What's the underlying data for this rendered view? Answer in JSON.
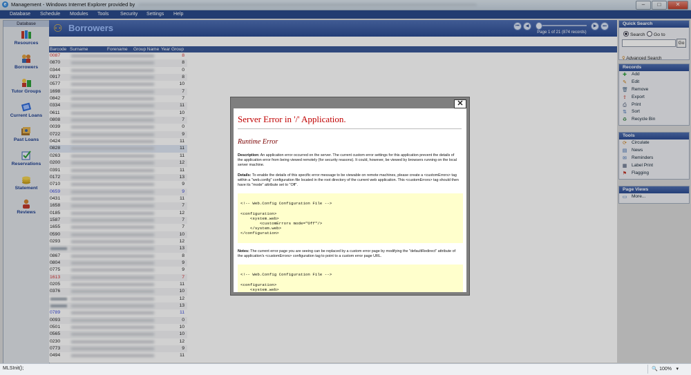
{
  "window": {
    "title": "Management - Windows Internet Explorer provided by",
    "btn_min": "–",
    "btn_max": "□",
    "btn_close": "✕"
  },
  "menu": [
    "Database",
    "Schedule",
    "Modules",
    "Tools",
    "Security",
    "Settings",
    "Help"
  ],
  "left_nav": {
    "header": "Database",
    "items": [
      {
        "label": "Resources",
        "icon": "books-icon"
      },
      {
        "label": "Borrowers",
        "icon": "people-icon"
      },
      {
        "label": "Tutor Groups",
        "icon": "tutor-group-icon"
      },
      {
        "label": "Current Loans",
        "icon": "current-loans-icon"
      },
      {
        "label": "Past Loans",
        "icon": "past-loans-icon"
      },
      {
        "label": "Reservations",
        "icon": "reservations-icon"
      },
      {
        "label": "Statement",
        "icon": "statement-icon"
      },
      {
        "label": "Reviews",
        "icon": "reviews-icon"
      }
    ]
  },
  "main": {
    "title": "Borrowers",
    "page_info": "Page 1 of 21 (874 records)",
    "columns": [
      "Barcode",
      "Surname",
      "Forename",
      "Group Name",
      "Year Group"
    ],
    "rows": [
      {
        "barcode": "0087",
        "year": "8",
        "style": "red"
      },
      {
        "barcode": "0870",
        "year": "8",
        "style": ""
      },
      {
        "barcode": "0344",
        "year": "0",
        "style": ""
      },
      {
        "barcode": "0917",
        "year": "8",
        "style": ""
      },
      {
        "barcode": "0577",
        "year": "10",
        "style": ""
      },
      {
        "barcode": "1698",
        "year": "7",
        "style": ""
      },
      {
        "barcode": "0842",
        "year": "7",
        "style": ""
      },
      {
        "barcode": "0334",
        "year": "11",
        "style": ""
      },
      {
        "barcode": "0611",
        "year": "10",
        "style": ""
      },
      {
        "barcode": "0808",
        "year": "7",
        "style": ""
      },
      {
        "barcode": "0039",
        "year": "0",
        "style": ""
      },
      {
        "barcode": "0722",
        "year": "9",
        "style": ""
      },
      {
        "barcode": "0424",
        "year": "11",
        "style": ""
      },
      {
        "barcode": "0828",
        "year": "11",
        "style": "sel"
      },
      {
        "barcode": "0263",
        "year": "11",
        "style": ""
      },
      {
        "barcode": "0200",
        "year": "12",
        "style": ""
      },
      {
        "barcode": "0391",
        "year": "11",
        "style": ""
      },
      {
        "barcode": "0172",
        "year": "13",
        "style": ""
      },
      {
        "barcode": "0710",
        "year": "9",
        "style": ""
      },
      {
        "barcode": "0659",
        "year": "9",
        "style": "blue"
      },
      {
        "barcode": "0431",
        "year": "11",
        "style": ""
      },
      {
        "barcode": "1658",
        "year": "7",
        "style": ""
      },
      {
        "barcode": "0185",
        "year": "12",
        "style": ""
      },
      {
        "barcode": "1587",
        "year": "7",
        "style": ""
      },
      {
        "barcode": "1655",
        "year": "7",
        "style": ""
      },
      {
        "barcode": "0590",
        "year": "10",
        "style": ""
      },
      {
        "barcode": "0293",
        "year": "12",
        "style": ""
      },
      {
        "barcode": "",
        "year": "13",
        "style": "hid"
      },
      {
        "barcode": "0867",
        "year": "8",
        "style": ""
      },
      {
        "barcode": "0804",
        "year": "9",
        "style": ""
      },
      {
        "barcode": "0775",
        "year": "9",
        "style": ""
      },
      {
        "barcode": "1613",
        "year": "7",
        "style": "red"
      },
      {
        "barcode": "0205",
        "year": "11",
        "style": ""
      },
      {
        "barcode": "0376",
        "year": "10",
        "style": ""
      },
      {
        "barcode": "",
        "year": "12",
        "style": "hid"
      },
      {
        "barcode": "",
        "year": "13",
        "style": "hid"
      },
      {
        "barcode": "0789",
        "year": "11",
        "style": "blue"
      },
      {
        "barcode": "0093",
        "year": "0",
        "style": ""
      },
      {
        "barcode": "0501",
        "year": "10",
        "style": ""
      },
      {
        "barcode": "0565",
        "year": "10",
        "style": ""
      },
      {
        "barcode": "0230",
        "year": "12",
        "style": ""
      },
      {
        "barcode": "0773",
        "year": "9",
        "style": ""
      },
      {
        "barcode": "0494",
        "year": "11",
        "style": ""
      }
    ]
  },
  "quick_search": {
    "header": "Quick Search",
    "opt_search": "Search",
    "opt_goto": "Go to",
    "input_value": "",
    "go_label": "Go",
    "advanced": "Advanced Search"
  },
  "records": {
    "header": "Records",
    "items": [
      {
        "label": "Add",
        "icon": "add-icon",
        "glyph": "✚",
        "color": "#2e9e3a"
      },
      {
        "label": "Edit",
        "icon": "pencil-icon",
        "glyph": "✎",
        "color": "#c87a12"
      },
      {
        "label": "Remove",
        "icon": "trash-icon",
        "glyph": "🗑",
        "color": "#4a6a8a"
      },
      {
        "label": "Export",
        "icon": "export-icon",
        "glyph": "⇪",
        "color": "#c0392b"
      },
      {
        "label": "Print",
        "icon": "printer-icon",
        "glyph": "⎙",
        "color": "#3a4a6a"
      },
      {
        "label": "Sort",
        "icon": "sort-icon",
        "glyph": "⇅",
        "color": "#3a6ab0"
      },
      {
        "label": "Recycle Bin",
        "icon": "recycle-bin-icon",
        "glyph": "♻",
        "color": "#2e7d3a"
      }
    ]
  },
  "tools": {
    "header": "Tools",
    "items": [
      {
        "label": "Circulate",
        "icon": "circulate-icon",
        "glyph": "⟳",
        "color": "#c87a12"
      },
      {
        "label": "News",
        "icon": "news-icon",
        "glyph": "▤",
        "color": "#3a6ab0"
      },
      {
        "label": "Reminders",
        "icon": "reminders-icon",
        "glyph": "✉",
        "color": "#3a6ab0"
      },
      {
        "label": "Label Print",
        "icon": "label-print-icon",
        "glyph": "▦",
        "color": "#3a4a6a"
      },
      {
        "label": "Flagging",
        "icon": "flag-icon",
        "glyph": "⚑",
        "color": "#c0392b"
      }
    ]
  },
  "page_views": {
    "header": "Page Views",
    "items": [
      {
        "label": "More...",
        "icon": "page-view-icon",
        "glyph": "▭",
        "color": "#3a6ab0"
      }
    ]
  },
  "error_dialog": {
    "close": "✕",
    "heading": "Server Error in '/' Application.",
    "subheading": "Runtime Error",
    "description_label": "Description:",
    "description": " An application error occurred on the server. The current custom error settings for this application prevent the details of the application error from being viewed remotely (for security reasons). It could, however, be viewed by browsers running on the local server machine.",
    "details_label": "Details:",
    "details": " To enable the details of this specific error message to be viewable on remote machines, please create a <customErrors> tag within a \"web.config\" configuration file located in the root directory of the current web application. This <customErrors> tag should then have its \"mode\" attribute set to \"Off\".",
    "code1": "\n<!-- Web.Config Configuration File -->\n\n<configuration>\n    <system.web>\n        <customErrors mode=\"Off\"/>\n    </system.web>\n</configuration>\n",
    "notes_label": "Notes:",
    "notes": " The current error page you are seeing can be replaced by a custom error page by modifying the \"defaultRedirect\" attribute of the application's <customErrors> configuration tag to point to a custom error page URL.",
    "code2": "\n<!-- Web.Config Configuration File -->\n\n<configuration>\n    <system.web>"
  },
  "status": {
    "text": "MLSInit();",
    "zoom": "100%",
    "zoom_arrow": "▾"
  }
}
